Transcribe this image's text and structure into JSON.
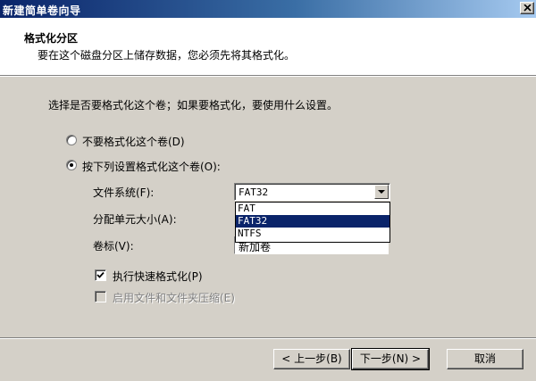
{
  "window": {
    "title": "新建简单卷向导"
  },
  "header": {
    "title": "格式化分区",
    "subtitle": "要在这个磁盘分区上储存数据，您必须先将其格式化。"
  },
  "main": {
    "question": "选择是否要格式化这个卷；如果要格式化，要使用什么设置。",
    "options": [
      {
        "label": "不要格式化这个卷(D)",
        "checked": false
      },
      {
        "label": "按下列设置格式化这个卷(O):",
        "checked": true
      }
    ],
    "fields": {
      "filesystem_label": "文件系统(F):",
      "filesystem_value": "FAT32",
      "allocation_label": "分配单元大小(A):",
      "volume_label": "卷标(V):",
      "volume_value": "新加卷"
    },
    "filesystem_options": [
      "FAT",
      "FAT32",
      "NTFS"
    ],
    "checkboxes": [
      {
        "label": "执行快速格式化(P)",
        "checked": true,
        "enabled": true
      },
      {
        "label": "启用文件和文件夹压缩(E)",
        "checked": false,
        "enabled": false
      }
    ]
  },
  "buttons": {
    "back": "< 上一步(B)",
    "next": "下一步(N) >",
    "cancel": "取消"
  },
  "icons": {
    "close": "close-icon",
    "dropdown": "chevron-down-icon",
    "check": "checkmark-icon"
  },
  "colors": {
    "titlebar": "#0a246a",
    "face": "#d4d0c8",
    "selection": "#0a246a"
  }
}
